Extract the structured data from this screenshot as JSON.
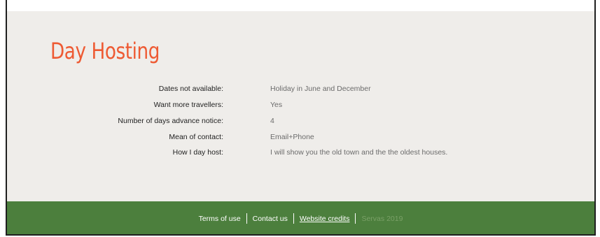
{
  "page": {
    "title": "Day Hosting"
  },
  "details": [
    {
      "label": "Dates not available:",
      "value": "Holiday in June and December"
    },
    {
      "label": "Want more travellers:",
      "value": "Yes"
    },
    {
      "label": "Number of days advance notice:",
      "value": "4"
    },
    {
      "label": "Mean of contact:",
      "value": "Email+Phone"
    },
    {
      "label": "How I day host:",
      "value": "I will show you the old town and the the oldest houses."
    }
  ],
  "footer": {
    "terms_label": "Terms of use",
    "contact_label": "Contact us",
    "credits_label": "Website credits",
    "copyright": "Servas 2019"
  },
  "colors": {
    "title": "#ee5a33",
    "content_bg": "#efedea",
    "footer_bg": "#4c7f3d"
  }
}
